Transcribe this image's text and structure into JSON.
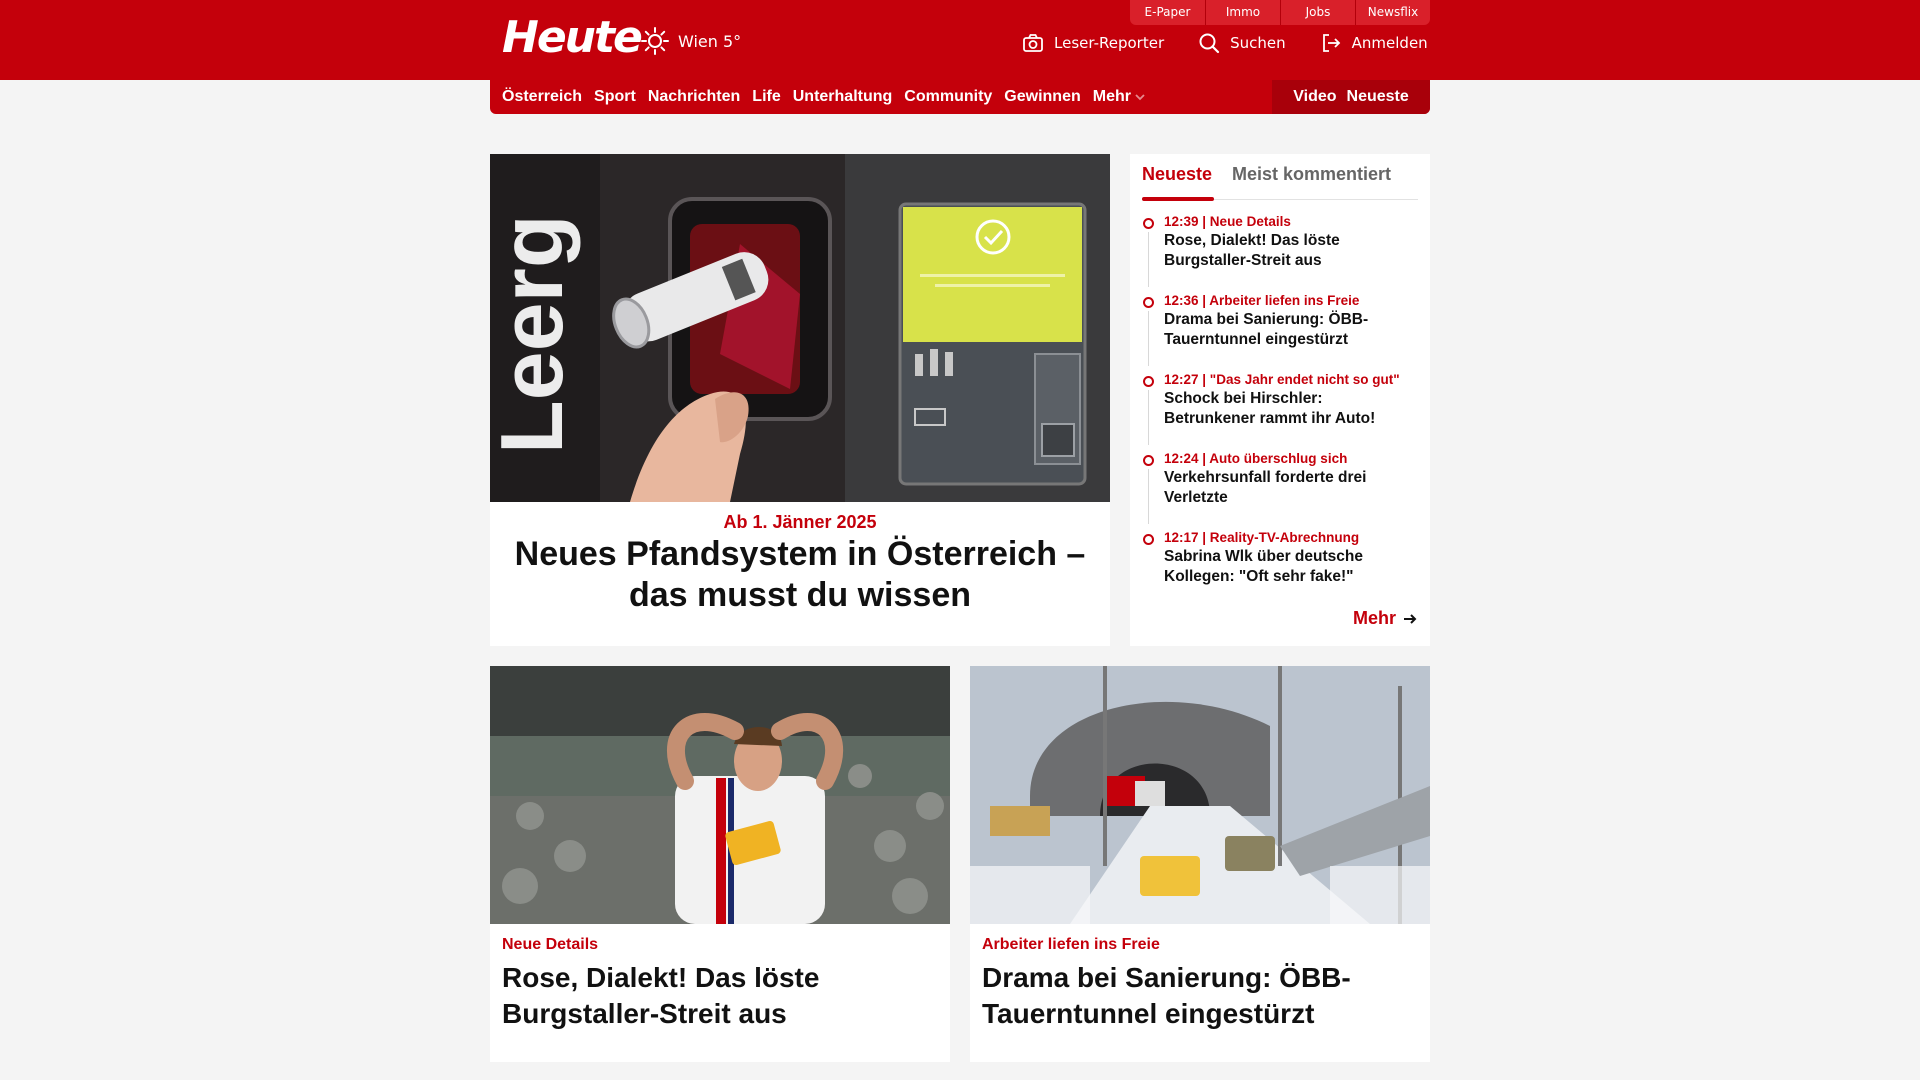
{
  "header": {
    "logo": "Heute",
    "weather": "Wien 5°",
    "service_tabs": [
      "E-Paper",
      "Immo",
      "Jobs",
      "Newsflix"
    ],
    "actions": {
      "reporter": "Leser-Reporter",
      "search": "Suchen",
      "login": "Anmelden"
    }
  },
  "nav": {
    "items": [
      "Österreich",
      "Sport",
      "Nachrichten",
      "Life",
      "Unterhaltung",
      "Community",
      "Gewinnen"
    ],
    "more": "Mehr",
    "right": [
      "Video",
      "Neueste"
    ]
  },
  "hero": {
    "kicker": "Ab 1. Jänner 2025",
    "title": "Neues Pfandsystem in Österreich – das musst du wissen",
    "image_icon": "deposit-machine-photo"
  },
  "sidebar": {
    "tabs": [
      "Neueste",
      "Meist kommentiert"
    ],
    "items": [
      {
        "meta": "12:39 | Neue Details",
        "title": "Rose, Dialekt! Das löste Burgstaller-Streit aus"
      },
      {
        "meta": "12:36 | Arbeiter liefen ins Freie",
        "title": "Drama bei Sanierung: ÖBB-Tauerntunnel eingestürzt"
      },
      {
        "meta": "12:27 | \"Das Jahr endet nicht so gut\"",
        "title": "Schock bei Hirschler: Betrunkener rammt ihr Auto!"
      },
      {
        "meta": "12:24 | Auto überschlug sich",
        "title": "Verkehrsunfall forderte drei Verletzte"
      },
      {
        "meta": "12:17 | Reality-TV-Abrechnung",
        "title": "Sabrina Wlk über deutsche Kollegen: \"Oft sehr fake!\""
      }
    ],
    "more": "Mehr"
  },
  "cards": [
    {
      "kicker": "Neue Details",
      "title": "Rose, Dialekt! Das löste Burgstaller-Streit aus",
      "image_icon": "football-player-photo"
    },
    {
      "kicker": "Arbeiter liefen ins Freie",
      "title": "Drama bei Sanierung: ÖBB-Tauerntunnel eingestürzt",
      "image_icon": "tunnel-construction-photo"
    }
  ],
  "colors": {
    "brand": "#c4000b",
    "brand_dark": "#a8000a",
    "background": "#f4f4f4"
  }
}
